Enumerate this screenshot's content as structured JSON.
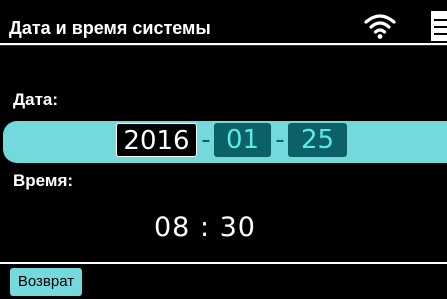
{
  "header": {
    "title": "Дата и время системы",
    "wifi_icon": "wifi-icon",
    "menu_icon": "menu-icon"
  },
  "date": {
    "label": "Дата:",
    "year": "2016",
    "separator": "-",
    "month": "01",
    "day": "25"
  },
  "time": {
    "label": "Время:",
    "value": "08 : 30"
  },
  "footer": {
    "back_label": "Возврат"
  },
  "colors": {
    "background": "#000000",
    "accent_band": "#74d9dc",
    "field_dark": "#0b6166",
    "field_text": "#5fe8ea",
    "text": "#ffffff"
  }
}
